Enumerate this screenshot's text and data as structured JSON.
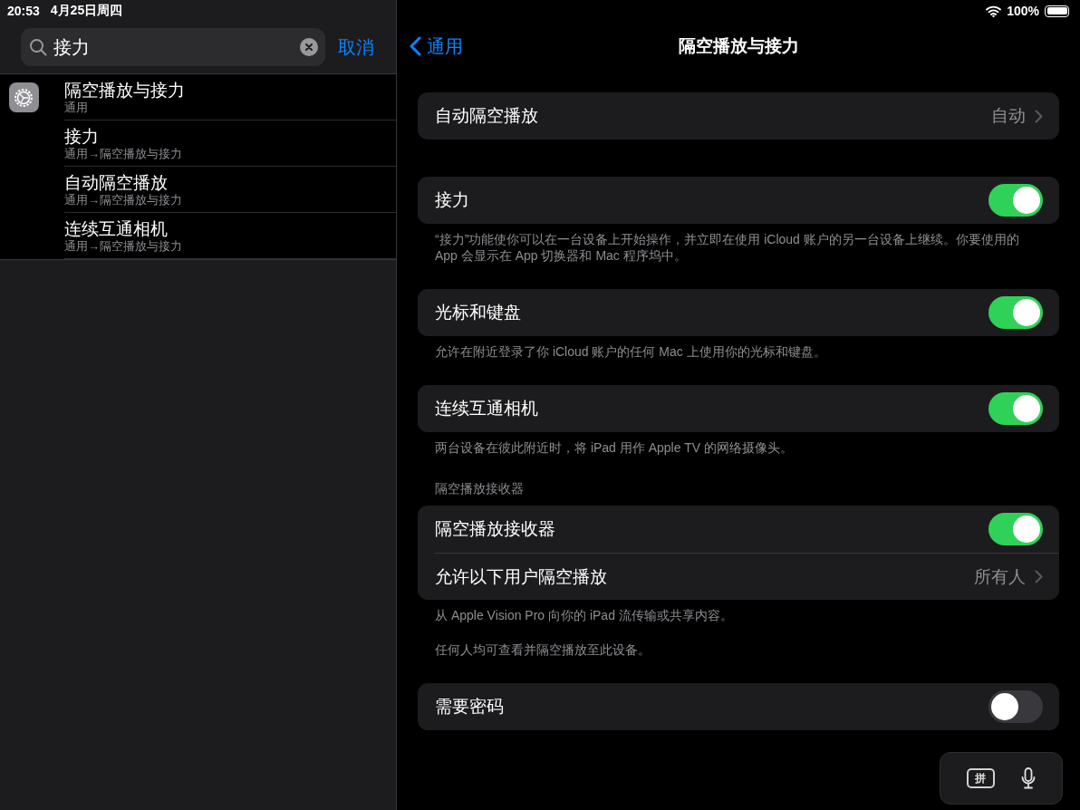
{
  "status_bar": {
    "time": "20:53",
    "date": "4月25日周四",
    "battery": "100%"
  },
  "sidebar": {
    "search": {
      "value": "接力"
    },
    "cancel": "取消",
    "results": [
      {
        "title": "隔空播放与接力",
        "path": "通用",
        "children": [
          {
            "title": "接力",
            "path": "通用→隔空播放与接力"
          },
          {
            "title": "自动隔空播放",
            "path": "通用→隔空播放与接力"
          },
          {
            "title": "连续互通相机",
            "path": "通用→隔空播放与接力"
          }
        ]
      }
    ]
  },
  "detail": {
    "back": "通用",
    "title": "隔空播放与接力",
    "groups": [
      {
        "rows": [
          {
            "kind": "link",
            "label": "自动隔空播放",
            "value": "自动"
          }
        ]
      },
      {
        "rows": [
          {
            "kind": "toggle",
            "label": "接力",
            "on": true
          }
        ],
        "footers": [
          "“接力”功能使你可以在一台设备上开始操作，并立即在使用 iCloud 账户的另一台设备上继续。你要使用的 App 会显示在 App 切换器和 Mac 程序坞中。"
        ]
      },
      {
        "rows": [
          {
            "kind": "toggle",
            "label": "光标和键盘",
            "on": true
          }
        ],
        "footers": [
          "允许在附近登录了你 iCloud 账户的任何 Mac 上使用你的光标和键盘。"
        ]
      },
      {
        "rows": [
          {
            "kind": "toggle",
            "label": "连续互通相机",
            "on": true
          }
        ],
        "footers": [
          "两台设备在彼此附近时，将 iPad 用作 Apple TV 的网络摄像头。"
        ]
      },
      {
        "header": "隔空播放接收器",
        "rows": [
          {
            "kind": "toggle",
            "label": "隔空播放接收器",
            "on": true
          },
          {
            "kind": "link",
            "label": "允许以下用户隔空播放",
            "value": "所有人"
          }
        ],
        "footers": [
          "从 Apple Vision Pro 向你的 iPad 流传输或共享内容。",
          "任何人均可查看并隔空播放至此设备。"
        ]
      },
      {
        "rows": [
          {
            "kind": "toggle",
            "label": "需要密码",
            "on": false
          }
        ]
      }
    ]
  },
  "keyboard_bar": {
    "key": "拼"
  }
}
